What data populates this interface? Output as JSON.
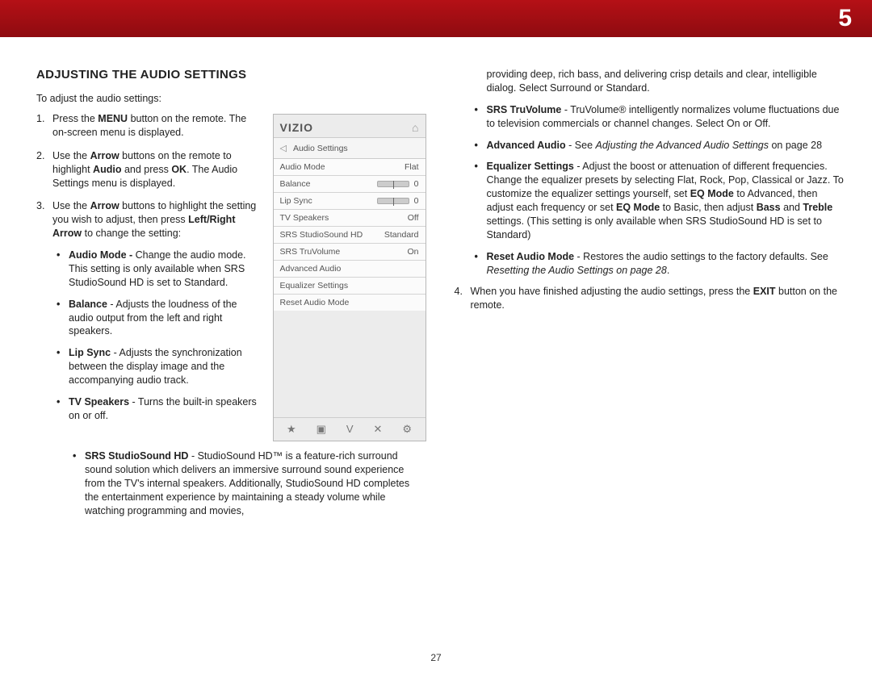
{
  "chapter": "5",
  "page_number": "27",
  "title": "ADJUSTING THE AUDIO SETTINGS",
  "intro": "To adjust the audio settings:",
  "steps": {
    "s1a": "Press the ",
    "s1b": "MENU",
    "s1c": " button on the remote. The on-screen menu is displayed.",
    "s2a": "Use the ",
    "s2b": "Arrow",
    "s2c": " buttons on the remote to highlight ",
    "s2d": "Audio",
    "s2e": " and press ",
    "s2f": "OK",
    "s2g": ". The Audio Settings menu is displayed.",
    "s3a": "Use the ",
    "s3b": "Arrow",
    "s3c": " buttons to highlight the setting you wish to adjust, then press ",
    "s3d": "Left/Right Arrow",
    "s3e": " to change the setting:",
    "s4a": "When you have finished adjusting the audio settings, press the ",
    "s4b": "EXIT",
    "s4c": " button on the remote."
  },
  "bullets_left": {
    "am_t": "Audio Mode - ",
    "am": "Change the audio mode. This setting is only available when SRS StudioSound HD is set to Standard.",
    "bal_t": "Balance",
    "bal": " - Adjusts the loudness of the audio output from the left and right speakers.",
    "ls_t": "Lip Sync",
    "ls": " - Adjusts the syn­chron­ization between the display image and the accompanying audio track.",
    "tv_t": "TV Speakers",
    "tv": " - Turns the built-in speakers on or off.",
    "ss_t": "SRS StudioSound HD",
    "ss": " - StudioSound HD™ is a feature-rich surround sound solution which delivers an immersive surround sound experience from the TV's internal speakers. Additionally, StudioSound HD completes the entertainment experience by maintaining a steady volume while watching programming and movies,"
  },
  "bullets_right": {
    "cont": "providing deep, rich bass, and delivering crisp details and clear, intelligible dialog. Select Surround or Standard.",
    "tru_t": "SRS TruVolume",
    "tru": " - TruVolume® intelligently normalizes volume fluctuations due to television commercials or channel changes. Select On or Off.",
    "aa_t": "Advanced Audio",
    "aa1": " - See ",
    "aa_i": "Adjusting the Advanced Audio Settings",
    "aa2": " on page 28",
    "eq_t": "Equalizer Settings",
    "eq1": " - Adjust the boost or attenuation of different frequencies. Change the equalizer presets by selecting Flat, Rock, Pop, Classical or Jazz. To customize the equalizer settings yourself, set ",
    "eq_b1": "EQ Mode",
    "eq2": " to Advanced, then adjust each frequency or set ",
    "eq_b2": "EQ Mode",
    "eq3": " to Basic, then adjust ",
    "eq_b3": "Bass",
    "eq4": " and ",
    "eq_b4": "Treble",
    "eq5": " settings. (This setting is only available when SRS StudioSound HD is set to Standard)",
    "r_t": "Reset Audio Mode",
    "r1": " - Restores the audio settings to the factory defaults. See ",
    "r_i": "Resetting the Audio Settings on page 28",
    "r2": "."
  },
  "osd": {
    "logo": "VIZIO",
    "header": "Audio Settings",
    "rows": [
      {
        "label": "Audio Mode",
        "value": "Flat"
      },
      {
        "label": "Balance",
        "value": "0",
        "slider": true
      },
      {
        "label": "Lip Sync",
        "value": "0",
        "slider": true
      },
      {
        "label": "TV Speakers",
        "value": "Off"
      },
      {
        "label": "SRS StudioSound HD",
        "value": "Standard"
      },
      {
        "label": "SRS TruVolume",
        "value": "On"
      },
      {
        "label": "Advanced Audio",
        "value": ""
      },
      {
        "label": "Equalizer Settings",
        "value": ""
      },
      {
        "label": "Reset Audio Mode",
        "value": ""
      }
    ],
    "footer_icons": [
      "★",
      "▣",
      "V",
      "✕",
      "⚙"
    ]
  }
}
